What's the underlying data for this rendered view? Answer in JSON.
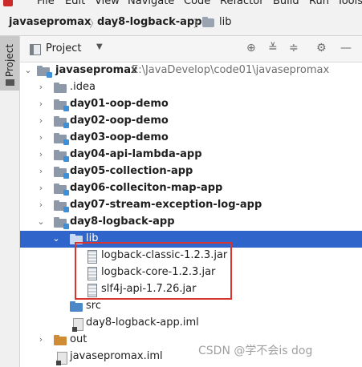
{
  "menu": {
    "items": [
      "File",
      "Edit",
      "View",
      "Navigate",
      "Code",
      "Refactor",
      "Build",
      "Run",
      "Tools"
    ]
  },
  "breadcrumb": {
    "items": [
      "javasepromax",
      "day8-logback-app",
      "lib"
    ]
  },
  "side_tab": {
    "label": "Project"
  },
  "project_panel": {
    "title": "Project"
  },
  "tree": [
    {
      "label": "javasepromax",
      "path": "E:\\JavaDevelop\\code01\\javasepromax"
    },
    {
      "label": ".idea"
    },
    {
      "label": "day01-oop-demo"
    },
    {
      "label": "day02-oop-demo"
    },
    {
      "label": "day03-oop-demo"
    },
    {
      "label": "day04-api-lambda-app"
    },
    {
      "label": "day05-collection-app"
    },
    {
      "label": "day06-colleciton-map-app"
    },
    {
      "label": "day07-stream-exception-log-app"
    },
    {
      "label": "day8-logback-app"
    },
    {
      "label": "lib"
    },
    {
      "label": "logback-classic-1.2.3.jar"
    },
    {
      "label": "logback-core-1.2.3.jar"
    },
    {
      "label": "slf4j-api-1.7.26.jar"
    },
    {
      "label": "src"
    },
    {
      "label": "day8-logback-app.iml"
    },
    {
      "label": "out"
    },
    {
      "label": "javasepromax.iml"
    }
  ],
  "watermark": "CSDN @学不会is dog",
  "colors": {
    "selection": "#2f65ca",
    "highlight_border": "#d9352f",
    "module_badge": "#3d8fd8"
  }
}
